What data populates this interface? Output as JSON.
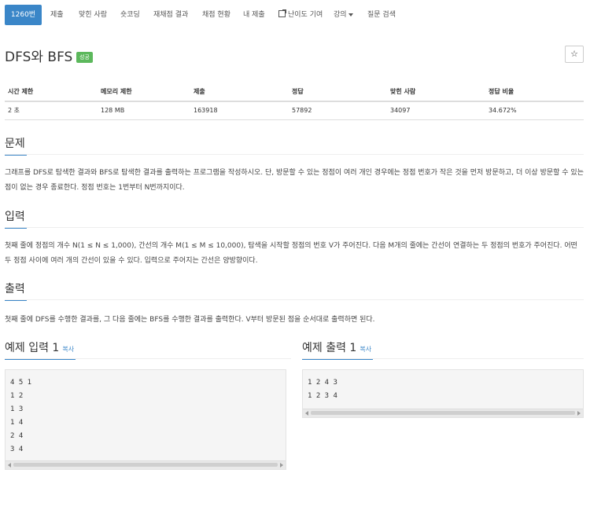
{
  "nav": {
    "tabs": [
      "1260번",
      "제출",
      "맞힌 사람",
      "숏코딩",
      "재채점 결과",
      "채점 현황",
      "내 제출",
      "난이도 기여",
      "강의",
      "질문 검색"
    ]
  },
  "problem": {
    "title": "DFS와 BFS",
    "badge": "성공",
    "star": "☆"
  },
  "stats": {
    "headers": [
      "시간 제한",
      "메모리 제한",
      "제출",
      "정답",
      "맞힌 사람",
      "정답 비율"
    ],
    "values": [
      "2 초",
      "128 MB",
      "163918",
      "57892",
      "34097",
      "34.672%"
    ]
  },
  "sections": {
    "problem_title": "문제",
    "problem_text": "그래프를 DFS로 탐색한 결과와 BFS로 탐색한 결과를 출력하는 프로그램을 작성하시오. 단, 방문할 수 있는 정점이 여러 개인 경우에는 정점 번호가 작은 것을 먼저 방문하고, 더 이상 방문할 수 있는 점이 없는 경우 종료한다. 정점 번호는 1번부터 N번까지이다.",
    "input_title": "입력",
    "input_text": "첫째 줄에 정점의 개수 N(1 ≤ N ≤ 1,000), 간선의 개수 M(1 ≤ M ≤ 10,000), 탐색을 시작할 정점의 번호 V가 주어진다. 다음 M개의 줄에는 간선이 연결하는 두 정점의 번호가 주어진다. 어떤 두 정점 사이에 여러 개의 간선이 있을 수 있다. 입력으로 주어지는 간선은 양방향이다.",
    "output_title": "출력",
    "output_text": "첫째 줄에 DFS를 수행한 결과를, 그 다음 줄에는 BFS를 수행한 결과를 출력한다. V부터 방문된 점을 순서대로 출력하면 된다."
  },
  "samples": {
    "input_title": "예제 입력 1",
    "output_title": "예제 출력 1",
    "copy_label": "복사",
    "input_lines": [
      "4 5 1",
      "1 2",
      "1 3",
      "1 4",
      "2 4",
      "3 4"
    ],
    "output_lines": [
      "1 2 4 3",
      "1 2 3 4"
    ]
  }
}
